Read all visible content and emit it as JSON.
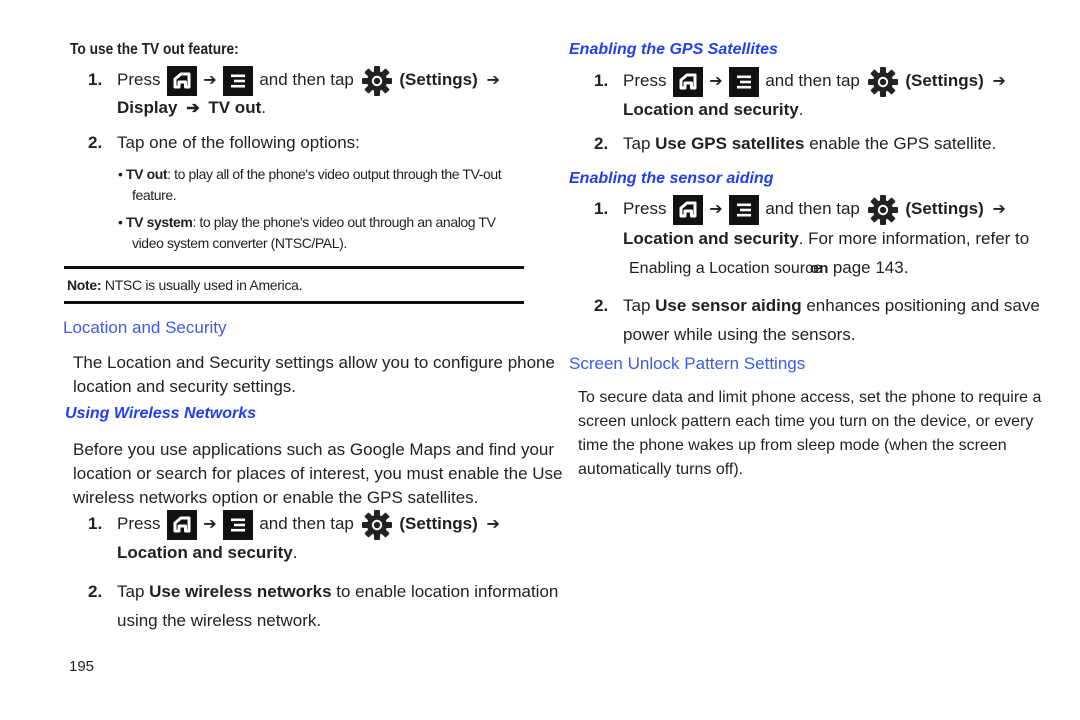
{
  "page_number": "195",
  "left": {
    "tvout": {
      "heading": "To use the TV out feature:",
      "step1": {
        "num": "1.",
        "press": "Press",
        "arrow": "➔",
        "then_tap": "and then tap",
        "settings": "(Settings)",
        "path_line2_a": "Display",
        "path_line2_b": "TV out",
        "period": "."
      },
      "step2": {
        "num": "2.",
        "text": "Tap one of the following options:"
      },
      "bullets": [
        {
          "bold": "TV out",
          "line1": ": to play all of the phone's video output through the TV-out",
          "line2": "feature."
        },
        {
          "bold": "TV system",
          "line1": ": to play the phone's video out through an analog TV",
          "line2": "video system converter (NTSC/PAL)."
        }
      ],
      "note_label": "Note:",
      "note_text": "NTSC is usually used in America."
    },
    "location": {
      "heading": "Location and Security",
      "intro_line1": "The Location and Security settings allow you to configure phone",
      "intro_line2": "location and security settings.",
      "wireless_heading": "Using Wireless Networks",
      "wireless_line1": "Before you use applications such as Google Maps and find your",
      "wireless_line2": "location or search for places of interest, you must enable the Use",
      "wireless_line3": "wireless networks option or enable the GPS satellites.",
      "step1": {
        "num": "1.",
        "press": "Press",
        "arrow": "➔",
        "then_tap": "and then tap",
        "settings": "(Settings)",
        "line2_bold": "Location and security",
        "period": "."
      },
      "step2": {
        "num": "2.",
        "tap": "Tap",
        "bold": "Use wireless networks",
        "line1_rest": "to enable location information",
        "line2": "using the wireless network."
      }
    }
  },
  "right": {
    "gps": {
      "heading": "Enabling the GPS Satellites",
      "step1": {
        "num": "1.",
        "press": "Press",
        "arrow": "➔",
        "then_tap": "and then tap",
        "settings": "(Settings)",
        "line2_bold": "Location and security",
        "period": "."
      },
      "step2": {
        "num": "2.",
        "tap": "Tap",
        "bold": "Use GPS satellites",
        "rest": "enable the GPS satellite."
      }
    },
    "sensor": {
      "heading": "Enabling the sensor aiding",
      "step1": {
        "num": "1.",
        "press": "Press",
        "arrow": "➔",
        "then_tap": "and then tap",
        "settings": "(Settings)",
        "line2_bold": "Location and security",
        "line2_rest": ". For more information, refer to",
        "line3_link": "Enabling a Location source",
        "line3_overlap": "on",
        "line3_rest": "page 143."
      },
      "step2": {
        "num": "2.",
        "tap": "Tap",
        "bold": "Use sensor aiding",
        "line1_rest": "enhances positioning and save",
        "line2": "power while using the sensors."
      }
    },
    "unlock": {
      "heading": "Screen Unlock Pattern Settings",
      "line1": "To secure data and limit phone access, set the phone to require a",
      "line2": "screen unlock pattern each time you turn on the device, or every",
      "line3": "time the phone wakes up from sleep mode (when the screen",
      "line4": "automatically turns off)."
    }
  },
  "icons": {
    "home": "home-key-icon",
    "menu": "menu-key-icon",
    "settings": "settings-gear-icon"
  },
  "colors": {
    "heading_blue": "#3a5bf0",
    "subheading_blue": "#1f3ff0",
    "text": "#231f20"
  }
}
